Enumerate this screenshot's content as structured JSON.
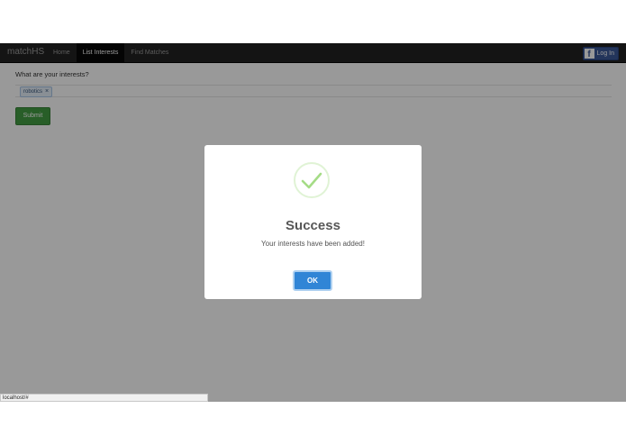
{
  "navbar": {
    "brand": "matchHS",
    "links": [
      {
        "label": "Home"
      },
      {
        "label": "List Interests"
      },
      {
        "label": "Find Matches"
      }
    ],
    "login": {
      "icon": "f",
      "label": "Log In"
    }
  },
  "form": {
    "question": "What are your interests?",
    "tags": [
      {
        "label": "robotics",
        "remove": "×"
      }
    ],
    "submit_label": "Submit"
  },
  "modal": {
    "icon": "checkmark-icon",
    "title": "Success",
    "message": "Your interests have been added!",
    "ok_label": "OK"
  },
  "statusbar": {
    "url": "localhost/#"
  },
  "colors": {
    "navbar": "#222222",
    "success_green": "#a5dc86",
    "submit_green": "#449d44",
    "ok_blue": "#3085d6",
    "facebook_blue": "#3b5998"
  }
}
